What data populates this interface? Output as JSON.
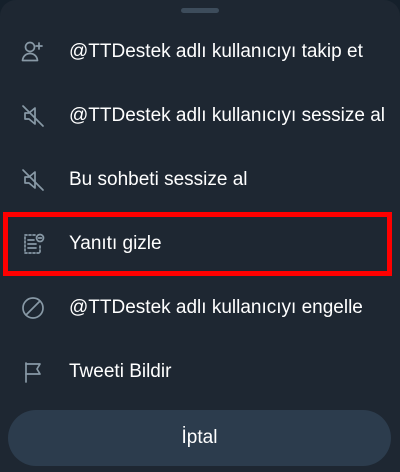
{
  "menu": {
    "items": [
      {
        "label": "@TTDestek adlı kullanıcıyı takip et",
        "icon": "add-user-icon"
      },
      {
        "label": "@TTDestek adlı kullanıcıyı sessize al",
        "icon": "mute-icon"
      },
      {
        "label": "Bu sohbeti sessize al",
        "icon": "mute-icon"
      },
      {
        "label": "Yanıtı gizle",
        "icon": "hide-reply-icon"
      },
      {
        "label": "@TTDestek adlı kullanıcıyı engelle",
        "icon": "block-icon"
      },
      {
        "label": "Tweeti Bildir",
        "icon": "flag-icon"
      }
    ]
  },
  "cancel_label": "İptal",
  "colors": {
    "background": "#15202b",
    "sheet": "#1e2732",
    "icon": "#8899a6",
    "cancel_button": "#2c3c4d",
    "highlight": "#ff0000"
  }
}
